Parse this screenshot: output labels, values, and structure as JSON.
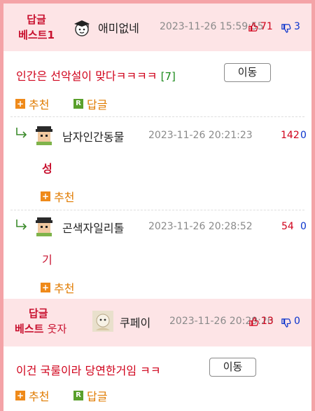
{
  "best1": {
    "tag_line1": "답글",
    "tag_line2": "베스트1",
    "nickname": "애미없네",
    "timestamp": "2023-11-26 15:59:55",
    "upvotes": "71",
    "downvotes": "3",
    "body": "인간은 선악설이 맞다ㅋㅋㅋㅋ",
    "reply_count": "[7]",
    "move_label": "이동",
    "recommend_label": "추천",
    "reply_label": "답글"
  },
  "replies": [
    {
      "nickname": "남자인간동물",
      "timestamp": "2023-11-26 20:21:23",
      "upvotes": "142",
      "downvotes": "0",
      "body": "성",
      "recommend_label": "추천"
    },
    {
      "nickname": "곤색자일리톨",
      "timestamp": "2023-11-26 20:28:52",
      "upvotes": "54",
      "downvotes": "0",
      "body": "기",
      "recommend_label": "추천"
    }
  ],
  "best2": {
    "tag_line1": "답글",
    "tag_line2": "베스트",
    "tag_suffix": "웃자",
    "nickname": "쿠페이",
    "timestamp": "2023-11-26 20:29:20",
    "upvotes": "13",
    "downvotes": "0",
    "body": "이건 국룰이라 당연한거임 ㅋㅋ",
    "move_label": "이동",
    "recommend_label": "추천",
    "reply_label": "답글"
  },
  "colors": {
    "border": "#f4a3a7",
    "best_header_bg": "#fde4e6",
    "accent_red": "#d0021b",
    "down_blue": "#0a33cc",
    "action_orange": "#e07b00"
  }
}
